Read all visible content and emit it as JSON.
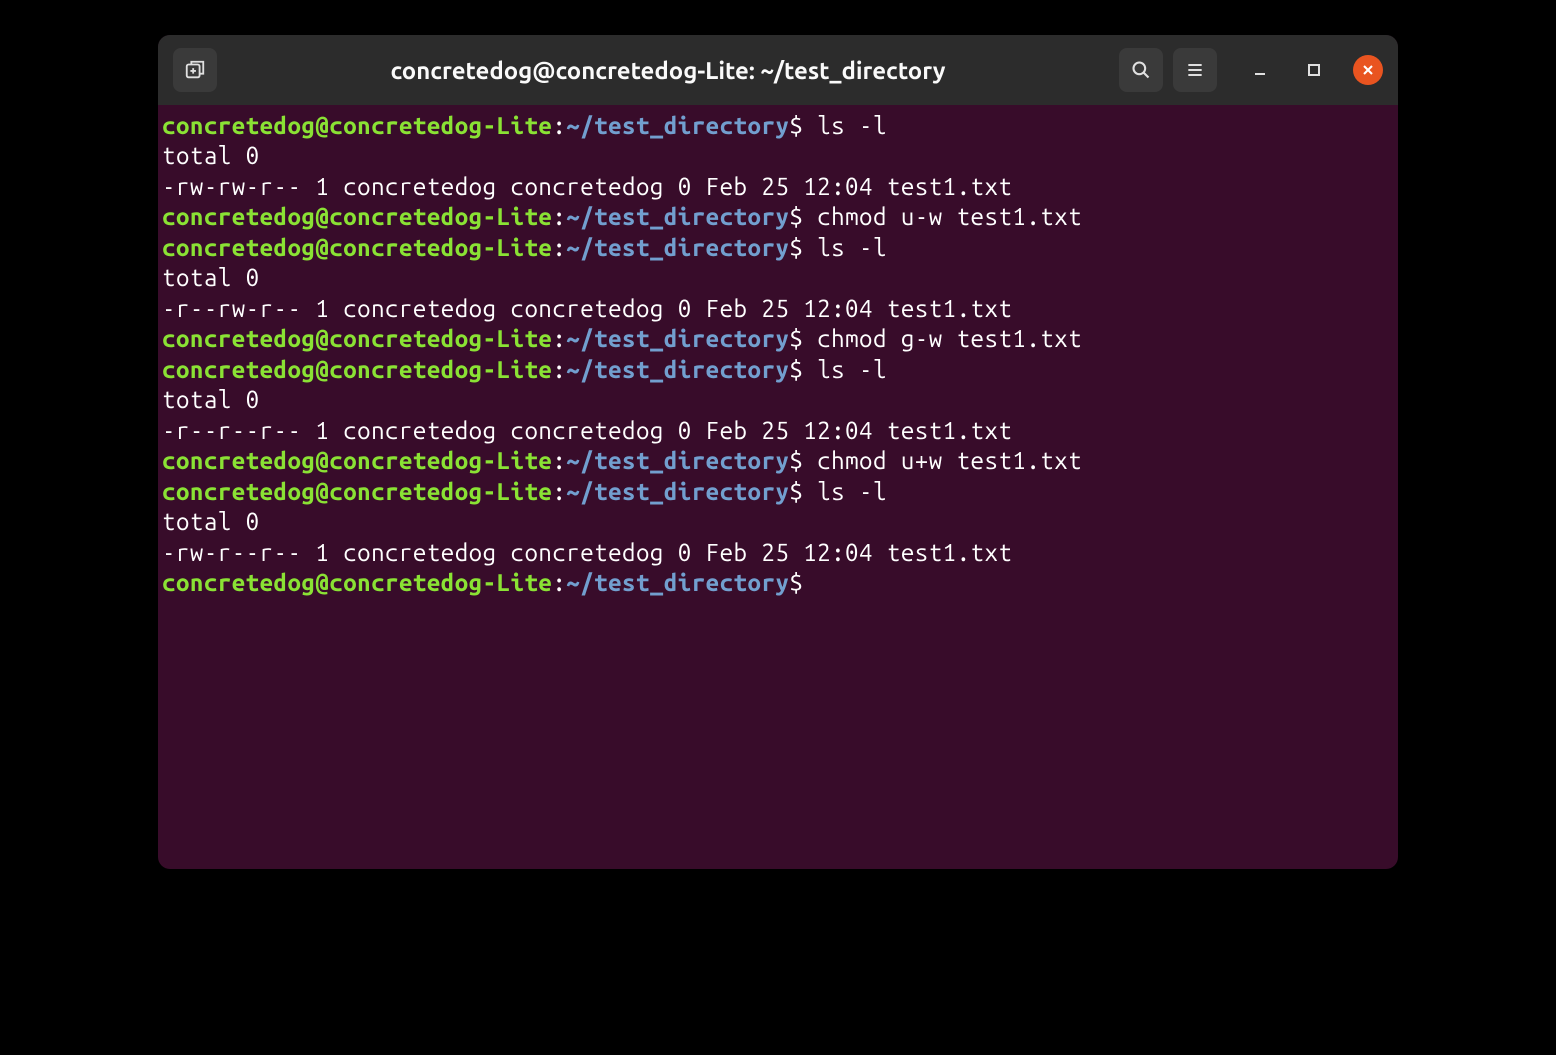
{
  "window": {
    "title": "concretedog@concretedog-Lite: ~/test_directory"
  },
  "prompt": {
    "user_host": "concretedog@concretedog-Lite",
    "colon": ":",
    "path": "~/test_directory",
    "dollar": "$"
  },
  "lines": [
    {
      "type": "prompt",
      "command": "ls -l"
    },
    {
      "type": "output",
      "text": "total 0"
    },
    {
      "type": "output",
      "text": "-rw-rw-r-- 1 concretedog concretedog 0 Feb 25 12:04 test1.txt"
    },
    {
      "type": "prompt",
      "command": "chmod u-w test1.txt"
    },
    {
      "type": "prompt",
      "command": "ls -l"
    },
    {
      "type": "output",
      "text": "total 0"
    },
    {
      "type": "output",
      "text": "-r--rw-r-- 1 concretedog concretedog 0 Feb 25 12:04 test1.txt"
    },
    {
      "type": "prompt",
      "command": "chmod g-w test1.txt"
    },
    {
      "type": "prompt",
      "command": "ls -l"
    },
    {
      "type": "output",
      "text": "total 0"
    },
    {
      "type": "output",
      "text": "-r--r--r-- 1 concretedog concretedog 0 Feb 25 12:04 test1.txt"
    },
    {
      "type": "prompt",
      "command": "chmod u+w test1.txt"
    },
    {
      "type": "prompt",
      "command": "ls -l"
    },
    {
      "type": "output",
      "text": "total 0"
    },
    {
      "type": "output",
      "text": "-rw-r--r-- 1 concretedog concretedog 0 Feb 25 12:04 test1.txt"
    },
    {
      "type": "prompt",
      "command": ""
    }
  ]
}
